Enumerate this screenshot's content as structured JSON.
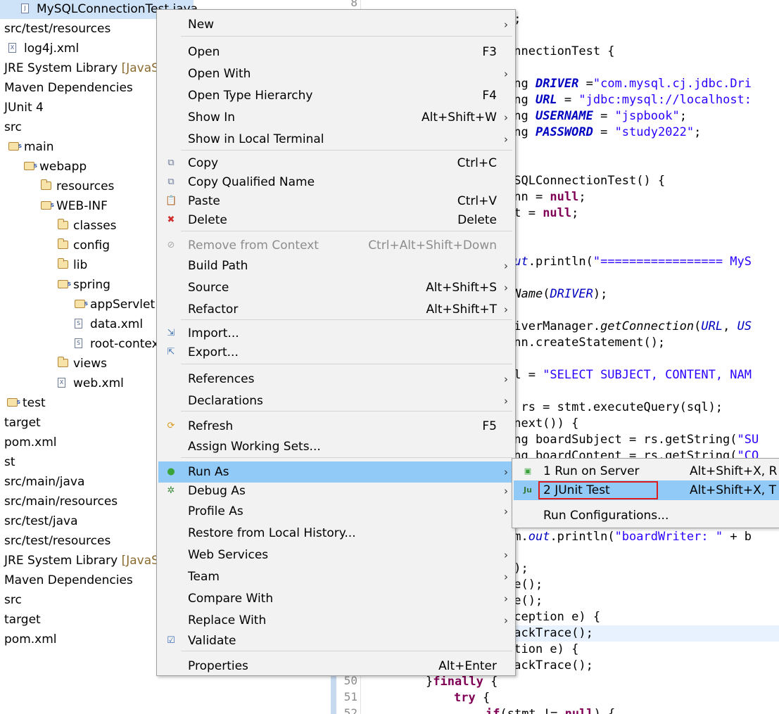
{
  "tree": {
    "items": [
      {
        "label": "MySQLConnectionTest.java",
        "icon": "java-file-icon",
        "arrow": "›",
        "indent": 30,
        "selected": true
      },
      {
        "label": "src/test/resources",
        "icon": "package-folder-icon",
        "arrow": "",
        "indent": 0
      },
      {
        "label": "log4j.xml",
        "icon": "xml-file-icon",
        "arrow": "",
        "indent": 12
      },
      {
        "label": "JRE System Library",
        "suffix": " [JavaSE-",
        "icon": "library-icon",
        "arrow": "",
        "indent": 0
      },
      {
        "label": "Maven Dependencies",
        "icon": "library-icon",
        "arrow": "",
        "indent": 0
      },
      {
        "label": "JUnit 4",
        "icon": "library-icon",
        "arrow": "",
        "indent": 0
      },
      {
        "label": "src",
        "icon": "folder-icon",
        "arrow": "",
        "indent": 0
      },
      {
        "label": "main",
        "icon": "package-folder-icon",
        "arrow": "",
        "indent": 12
      },
      {
        "label": "webapp",
        "icon": "package-folder-icon",
        "arrow": "⌄",
        "indent": 34
      },
      {
        "label": "resources",
        "icon": "folder-icon",
        "arrow": "",
        "indent": 58
      },
      {
        "label": "WEB-INF",
        "icon": "package-folder-icon",
        "arrow": "⌄",
        "indent": 58
      },
      {
        "label": "classes",
        "icon": "folder-icon",
        "arrow": "",
        "indent": 82
      },
      {
        "label": "config",
        "icon": "folder-icon",
        "arrow": "›",
        "indent": 82
      },
      {
        "label": "lib",
        "icon": "folder-icon",
        "arrow": "›",
        "indent": 82
      },
      {
        "label": "spring",
        "icon": "package-folder-icon",
        "arrow": "⌄",
        "indent": 82
      },
      {
        "label": "appServlet",
        "icon": "package-folder-icon",
        "arrow": "›",
        "indent": 106
      },
      {
        "label": "data.xml",
        "icon": "spring-xml-icon",
        "arrow": "",
        "indent": 106
      },
      {
        "label": "root-context",
        "icon": "spring-xml-icon",
        "arrow": "",
        "indent": 106
      },
      {
        "label": "views",
        "icon": "folder-icon",
        "arrow": "›",
        "indent": 82
      },
      {
        "label": "web.xml",
        "icon": "xml-file-icon",
        "arrow": "",
        "indent": 82
      },
      {
        "label": "test",
        "icon": "package-folder-icon",
        "arrow": "",
        "indent": 10
      },
      {
        "label": "target",
        "icon": "folder-icon",
        "arrow": "",
        "indent": 0
      },
      {
        "label": "pom.xml",
        "icon": "xml-file-icon",
        "arrow": "",
        "indent": 0
      },
      {
        "label": "st",
        "icon": "project-icon",
        "arrow": "",
        "indent": 0
      },
      {
        "label": "src/main/java",
        "icon": "package-folder-icon",
        "arrow": "",
        "indent": 0
      },
      {
        "label": "src/main/resources",
        "icon": "package-folder-icon",
        "arrow": "",
        "indent": 0
      },
      {
        "label": "src/test/java",
        "icon": "package-folder-icon",
        "arrow": "",
        "indent": 0
      },
      {
        "label": "src/test/resources",
        "icon": "package-folder-icon",
        "arrow": "",
        "indent": 0
      },
      {
        "label": "JRE System Library",
        "suffix": " [JavaSE-",
        "icon": "library-icon",
        "arrow": "",
        "indent": 0
      },
      {
        "label": "Maven Dependencies",
        "icon": "library-icon",
        "arrow": "",
        "indent": 0
      },
      {
        "label": "src",
        "icon": "folder-icon",
        "arrow": "",
        "indent": 0
      },
      {
        "label": "target",
        "icon": "folder-icon",
        "arrow": "",
        "indent": 0
      },
      {
        "label": "pom.xml",
        "icon": "xml-file-icon",
        "arrow": "",
        "indent": 0
      }
    ]
  },
  "editor": {
    "line_numbers": [
      "8",
      "50",
      "51",
      "52"
    ],
    "lines": [
      [
        [
          "t;",
          ""
        ]
      ],
      [
        [
          "onnectionTest {",
          ""
        ]
      ],
      [
        [
          "ing ",
          ""
        ],
        [
          "DRIVER",
          "fldb"
        ],
        [
          " =",
          ""
        ],
        [
          "\"com.mysql.cj.jdbc.Dri",
          "str"
        ]
      ],
      [
        [
          "ing ",
          ""
        ],
        [
          "URL",
          "fldb"
        ],
        [
          " = ",
          ""
        ],
        [
          "\"jdbc:mysql://localhost:",
          "str"
        ]
      ],
      [
        [
          "ing ",
          ""
        ],
        [
          "USERNAME",
          "fldb"
        ],
        [
          " = ",
          ""
        ],
        [
          "\"jspbook\"",
          "str"
        ],
        [
          ";",
          ""
        ]
      ],
      [
        [
          "ing ",
          ""
        ],
        [
          "PASSWORD",
          "fldb"
        ],
        [
          " = ",
          ""
        ],
        [
          "\"study2022\"",
          "str"
        ],
        [
          ";",
          ""
        ]
      ],
      [
        [
          "ySQLConnectionTest() {",
          ""
        ]
      ],
      [
        [
          "onn = ",
          ""
        ],
        [
          "null",
          "kw"
        ],
        [
          ";",
          ""
        ]
      ],
      [
        [
          "mt = ",
          ""
        ],
        [
          "null",
          "kw"
        ],
        [
          ";",
          ""
        ]
      ],
      [
        [
          "out",
          "fld"
        ],
        [
          ".println(",
          ""
        ],
        [
          "\"================= MyS",
          "str"
        ]
      ],
      [
        [
          "rName",
          "met"
        ],
        [
          "(",
          ""
        ],
        [
          "DRIVER",
          "fld"
        ],
        [
          ");",
          ""
        ]
      ],
      [
        [
          "riverManager.",
          ""
        ],
        [
          "getConnection",
          "met"
        ],
        [
          "(",
          ""
        ],
        [
          "URL",
          "fld"
        ],
        [
          ", ",
          ""
        ],
        [
          "US",
          "fld"
        ]
      ],
      [
        [
          "onn.createStatement();",
          ""
        ]
      ],
      [
        [
          "ql = ",
          ""
        ],
        [
          "\"SELECT SUBJECT, CONTENT, NAM",
          "str"
        ]
      ],
      [
        [
          "t rs = stmt.executeQuery(sql);",
          ""
        ]
      ],
      [
        [
          ".next()) {",
          ""
        ]
      ],
      [
        [
          "ing boardSubject = rs.getString(",
          ""
        ],
        [
          "\"SU",
          "str"
        ]
      ],
      [
        [
          "ing boardContent = rs.getString(",
          ""
        ],
        [
          "\"CO",
          "str"
        ]
      ],
      [
        [
          "em.",
          ""
        ],
        [
          "out",
          "fld"
        ],
        [
          ".println(",
          ""
        ],
        [
          "\"boardWriter: \"",
          "str"
        ],
        [
          " + b",
          ""
        ]
      ],
      [
        [
          "();",
          ""
        ]
      ],
      [
        [
          "se();",
          ""
        ]
      ],
      [
        [
          "se();",
          ""
        ]
      ],
      [
        [
          "xception e) {",
          ""
        ]
      ],
      [
        [
          "tackTrace();",
          ""
        ]
      ],
      [
        [
          "ption e) {",
          ""
        ]
      ],
      [
        [
          "tackTrace();",
          ""
        ]
      ],
      [
        [
          "}",
          ""
        ],
        [
          "finally",
          "kw"
        ],
        [
          " {",
          ""
        ]
      ],
      [
        [
          "try",
          "kw"
        ],
        [
          " {",
          ""
        ]
      ],
      [
        [
          "if",
          "kw"
        ],
        [
          "(stmt != ",
          ""
        ],
        [
          "null",
          "kw"
        ],
        [
          ") {",
          ""
        ]
      ]
    ]
  },
  "context_menu": {
    "items": [
      {
        "label": "New",
        "shortcut": "",
        "submenu": true,
        "icon": ""
      },
      {
        "sep": true
      },
      {
        "label": "Open",
        "shortcut": "F3",
        "submenu": false,
        "icon": ""
      },
      {
        "label": "Open With",
        "shortcut": "",
        "submenu": true,
        "icon": ""
      },
      {
        "label": "Open Type Hierarchy",
        "shortcut": "F4",
        "submenu": false,
        "icon": ""
      },
      {
        "label": "Show In",
        "shortcut": "Alt+Shift+W",
        "submenu": true,
        "icon": ""
      },
      {
        "label": "Show in Local Terminal",
        "shortcut": "",
        "submenu": true,
        "icon": ""
      },
      {
        "sep": true
      },
      {
        "label": "Copy",
        "shortcut": "Ctrl+C",
        "submenu": false,
        "icon": "copy-icon"
      },
      {
        "label": "Copy Qualified Name",
        "shortcut": "",
        "submenu": false,
        "icon": "copy-qualified-name-icon"
      },
      {
        "label": "Paste",
        "shortcut": "Ctrl+V",
        "submenu": false,
        "icon": "paste-icon"
      },
      {
        "label": "Delete",
        "shortcut": "Delete",
        "submenu": false,
        "icon": "delete-icon"
      },
      {
        "sep": true
      },
      {
        "label": "Remove from Context",
        "shortcut": "Ctrl+Alt+Shift+Down",
        "submenu": false,
        "icon": "remove-context-icon",
        "disabled": true
      },
      {
        "label": "Build Path",
        "shortcut": "",
        "submenu": true,
        "icon": ""
      },
      {
        "label": "Source",
        "shortcut": "Alt+Shift+S",
        "submenu": true,
        "icon": ""
      },
      {
        "label": "Refactor",
        "shortcut": "Alt+Shift+T",
        "submenu": true,
        "icon": ""
      },
      {
        "sep": true
      },
      {
        "label": "Import...",
        "shortcut": "",
        "submenu": false,
        "icon": "import-icon"
      },
      {
        "label": "Export...",
        "shortcut": "",
        "submenu": false,
        "icon": "export-icon"
      },
      {
        "sep": true
      },
      {
        "label": "References",
        "shortcut": "",
        "submenu": true,
        "icon": ""
      },
      {
        "label": "Declarations",
        "shortcut": "",
        "submenu": true,
        "icon": ""
      },
      {
        "sep": true
      },
      {
        "label": "Refresh",
        "shortcut": "F5",
        "submenu": false,
        "icon": "refresh-icon"
      },
      {
        "label": "Assign Working Sets...",
        "shortcut": "",
        "submenu": false,
        "icon": ""
      },
      {
        "sep": true
      },
      {
        "label": "Run As",
        "shortcut": "",
        "submenu": true,
        "icon": "run-icon",
        "hover": true
      },
      {
        "label": "Debug As",
        "shortcut": "",
        "submenu": true,
        "icon": "debug-icon"
      },
      {
        "label": "Profile As",
        "shortcut": "",
        "submenu": true,
        "icon": ""
      },
      {
        "label": "Restore from Local History...",
        "shortcut": "",
        "submenu": false,
        "icon": ""
      },
      {
        "label": "Web Services",
        "shortcut": "",
        "submenu": true,
        "icon": ""
      },
      {
        "label": "Team",
        "shortcut": "",
        "submenu": true,
        "icon": ""
      },
      {
        "label": "Compare With",
        "shortcut": "",
        "submenu": true,
        "icon": ""
      },
      {
        "label": "Replace With",
        "shortcut": "",
        "submenu": true,
        "icon": ""
      },
      {
        "label": "Validate",
        "shortcut": "",
        "submenu": false,
        "icon": "checkbox-checked-icon"
      },
      {
        "sep": true
      },
      {
        "label": "Properties",
        "shortcut": "Alt+Enter",
        "submenu": false,
        "icon": ""
      }
    ]
  },
  "run_as_submenu": {
    "items": [
      {
        "label": "1 Run on Server",
        "shortcut": "Alt+Shift+X, R",
        "icon": "server-run-icon"
      },
      {
        "label": "2 JUnit Test",
        "shortcut": "Alt+Shift+X, T",
        "icon": "junit-icon",
        "hover": true
      },
      {
        "label": "Run Configurations...",
        "shortcut": "",
        "icon": ""
      }
    ]
  },
  "colors": {
    "menu_bg": "#f2f2f2",
    "menu_hover": "#91c9f7",
    "tree_selection": "#cfe3f8",
    "highlight_box": "#e01b1b",
    "keyword": "#7f0055",
    "string": "#2a00ff",
    "field": "#0000c0"
  }
}
